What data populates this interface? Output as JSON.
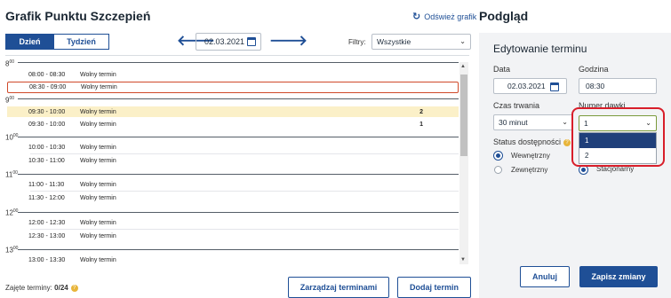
{
  "left": {
    "title": "Grafik Punktu Szczepień",
    "refresh_label": "Odśwież grafik",
    "view_tabs": [
      "Dzień",
      "Tydzień"
    ],
    "date": "02.03.2021",
    "filter_label": "Filtry:",
    "filter_value": "Wszystkie",
    "hours": [
      {
        "h": "8",
        "m": "00"
      },
      {
        "h": "9",
        "m": "00"
      },
      {
        "h": "10",
        "m": "00"
      },
      {
        "h": "11",
        "m": "00"
      },
      {
        "h": "12",
        "m": "00"
      },
      {
        "h": "13",
        "m": "00"
      }
    ],
    "slots": [
      {
        "time": "08:00 - 08:30",
        "status": "Wolny termin",
        "count": ""
      },
      {
        "time": "08:30 - 09:00",
        "status": "Wolny termin",
        "count": ""
      },
      {
        "time": "09:30 - 10:00",
        "status": "Wolny termin",
        "count": "2"
      },
      {
        "time": "09:30 - 10:00",
        "status": "Wolny termin",
        "count": "1"
      },
      {
        "time": "10:00 - 10:30",
        "status": "Wolny termin",
        "count": ""
      },
      {
        "time": "10:30 - 11:00",
        "status": "Wolny termin",
        "count": ""
      },
      {
        "time": "11:00 - 11:30",
        "status": "Wolny termin",
        "count": ""
      },
      {
        "time": "11:30 - 12:00",
        "status": "Wolny termin",
        "count": ""
      },
      {
        "time": "12:00 - 12:30",
        "status": "Wolny termin",
        "count": ""
      },
      {
        "time": "12:30 - 13:00",
        "status": "Wolny termin",
        "count": ""
      },
      {
        "time": "13:00 - 13:30",
        "status": "Wolny termin",
        "count": ""
      }
    ],
    "occupied_label": "Zajęte terminy:",
    "occupied_value": "0/24",
    "manage_button": "Zarządzaj terminami",
    "add_button": "Dodaj termin"
  },
  "right": {
    "title": "Podgląd",
    "card_title": "Edytowanie terminu",
    "date_label": "Data",
    "date_value": "02.03.2021",
    "time_label": "Godzina",
    "time_value": "08:30",
    "duration_label": "Czas trwania",
    "duration_value": "30 minut",
    "dose_label": "Numer dawki",
    "dose_value": "1",
    "dose_options": [
      "1",
      "2"
    ],
    "status_label": "Status dostępności",
    "status_options": [
      "Wewnętrzny",
      "Zewnętrzny"
    ],
    "location_option": "Stacjonarny",
    "cancel_button": "Anuluj",
    "save_button": "Zapisz zmiany"
  },
  "colors": {
    "primary": "#1f4f96",
    "selected_outline": "#d04a2a",
    "highlight_row": "#fbf0c8",
    "annotation_red": "#d81e2a"
  }
}
